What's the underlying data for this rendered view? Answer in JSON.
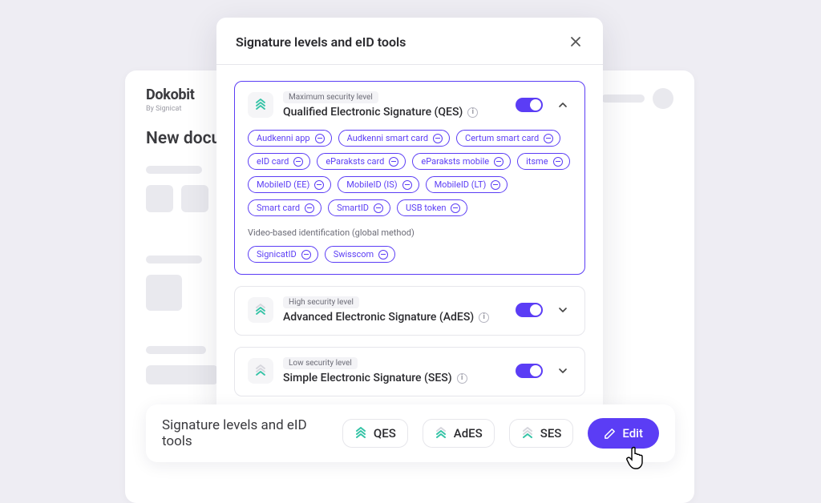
{
  "app": {
    "logo": "Dokobit",
    "logo_sub": "By Signicat",
    "page_title": "New docum"
  },
  "modal": {
    "title": "Signature levels and eID tools",
    "levels": [
      {
        "badge": "Maximum security level",
        "name": "Qualified Electronic Signature (QES)",
        "expanded": true,
        "icon_strength": 3,
        "chips_primary": [
          "Audkenni app",
          "Audkenni smart card",
          "Certum smart card",
          "eID card",
          "eParaksts card",
          "eParaksts mobile",
          "itsme",
          "MobileID (EE)",
          "MobileID (IS)",
          "MobileID (LT)",
          "Smart card",
          "SmartID",
          "USB token"
        ],
        "subheading": "Video-based identification (global method)",
        "chips_secondary": [
          "SignicatID",
          "Swisscom"
        ]
      },
      {
        "badge": "High security level",
        "name": "Advanced Electronic Signature (AdES)",
        "expanded": false,
        "icon_strength": 2
      },
      {
        "badge": "Low security level",
        "name": "Simple Electronic Signature (SES)",
        "expanded": false,
        "icon_strength": 1
      }
    ]
  },
  "bottom_bar": {
    "title": "Signature levels and eID tools",
    "items": [
      "QES",
      "AdES",
      "SES"
    ],
    "edit_label": "Edit"
  }
}
